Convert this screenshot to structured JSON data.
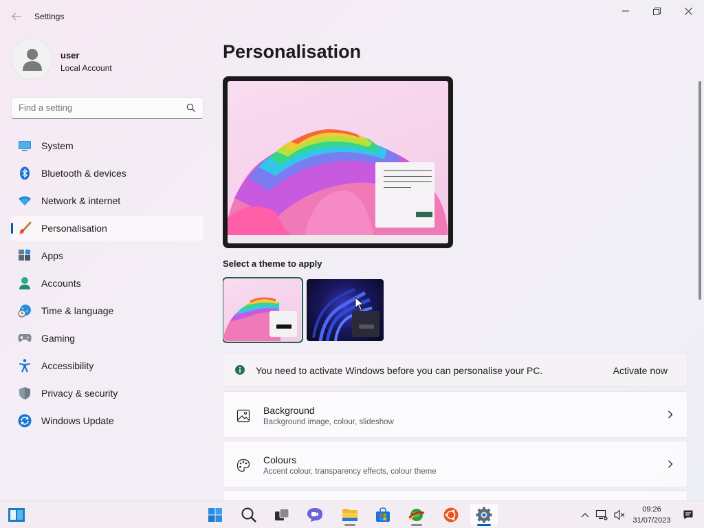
{
  "window": {
    "title": "Settings"
  },
  "user": {
    "name": "user",
    "account_type": "Local Account"
  },
  "search": {
    "placeholder": "Find a setting"
  },
  "sidebar": {
    "items": [
      {
        "label": "System",
        "icon": "system-icon",
        "active": false
      },
      {
        "label": "Bluetooth & devices",
        "icon": "bluetooth-icon",
        "active": false
      },
      {
        "label": "Network & internet",
        "icon": "wifi-icon",
        "active": false
      },
      {
        "label": "Personalisation",
        "icon": "brush-icon",
        "active": true
      },
      {
        "label": "Apps",
        "icon": "apps-icon",
        "active": false
      },
      {
        "label": "Accounts",
        "icon": "accounts-icon",
        "active": false
      },
      {
        "label": "Time & language",
        "icon": "globe-clock-icon",
        "active": false
      },
      {
        "label": "Gaming",
        "icon": "gamepad-icon",
        "active": false
      },
      {
        "label": "Accessibility",
        "icon": "accessibility-icon",
        "active": false
      },
      {
        "label": "Privacy & security",
        "icon": "shield-icon",
        "active": false
      },
      {
        "label": "Windows Update",
        "icon": "update-icon",
        "active": false
      }
    ]
  },
  "main": {
    "page_title": "Personalisation",
    "theme_label": "Select a theme to apply",
    "themes": [
      {
        "name": "light-bloom-theme",
        "selected": true
      },
      {
        "name": "dark-glow-theme",
        "selected": false
      }
    ],
    "activation": {
      "message": "You need to activate Windows before you can personalise your PC.",
      "action": "Activate now"
    },
    "settings_rows": [
      {
        "title": "Background",
        "subtitle": "Background image, colour, slideshow",
        "icon": "image-icon"
      },
      {
        "title": "Colours",
        "subtitle": "Accent colour, transparency effects, colour theme",
        "icon": "palette-icon"
      }
    ]
  },
  "taskbar": {
    "time": "09:26",
    "date": "31/07/2023",
    "accent_color": "#005fb8"
  }
}
